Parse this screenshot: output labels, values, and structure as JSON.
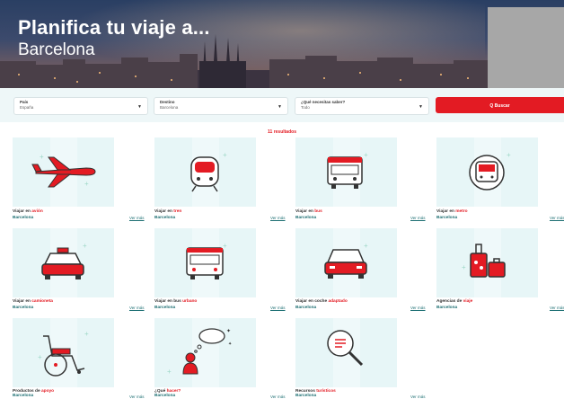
{
  "hero": {
    "title": "Planifica tu viaje a...",
    "city": "Barcelona"
  },
  "search": {
    "country_label": "País",
    "country_value": "España",
    "destination_label": "Destino",
    "destination_value": "Barcelona",
    "topic_label": "¿Qué necesitas saber?",
    "topic_value": "Todo",
    "button_label": "Q Buscar"
  },
  "results": {
    "count": "11 resultados",
    "link_label": "Ver más",
    "cards": [
      {
        "prefix": "Viajar en ",
        "highlight": "avión",
        "city": "Barcelona",
        "icon": "plane-icon"
      },
      {
        "prefix": "Viajar en ",
        "highlight": "tren",
        "city": "Barcelona",
        "icon": "train-icon"
      },
      {
        "prefix": "Viajar en ",
        "highlight": "bus",
        "city": "Barcelona",
        "icon": "bus-icon"
      },
      {
        "prefix": "Viajar en ",
        "highlight": "metro",
        "city": "Barcelona",
        "icon": "metro-icon"
      },
      {
        "prefix": "Viajar en ",
        "highlight": "camioneta",
        "city": "Barcelona",
        "icon": "taxi-icon"
      },
      {
        "prefix": "Viajar en bus ",
        "highlight": "urbano",
        "city": "Barcelona",
        "icon": "city-bus-icon"
      },
      {
        "prefix": "Viajar en coche ",
        "highlight": "adaptado",
        "city": "Barcelona",
        "icon": "car-icon"
      },
      {
        "prefix": "Agencias de ",
        "highlight": "viaje",
        "city": "Barcelona",
        "icon": "luggage-icon"
      },
      {
        "prefix": "Productos de ",
        "highlight": "apoyo",
        "city": "Barcelona",
        "icon": "wheelchair-icon"
      },
      {
        "prefix": "¿Qué ",
        "highlight": "hacer?",
        "city": "Barcelona",
        "icon": "person-thinking-icon"
      },
      {
        "prefix": "Recursos ",
        "highlight": "turísticos",
        "city": "Barcelona",
        "icon": "magnifier-icon"
      }
    ]
  },
  "colors": {
    "accent": "#e31b23",
    "teal": "#1d6f73",
    "card_bg": "#e7f6f7"
  }
}
